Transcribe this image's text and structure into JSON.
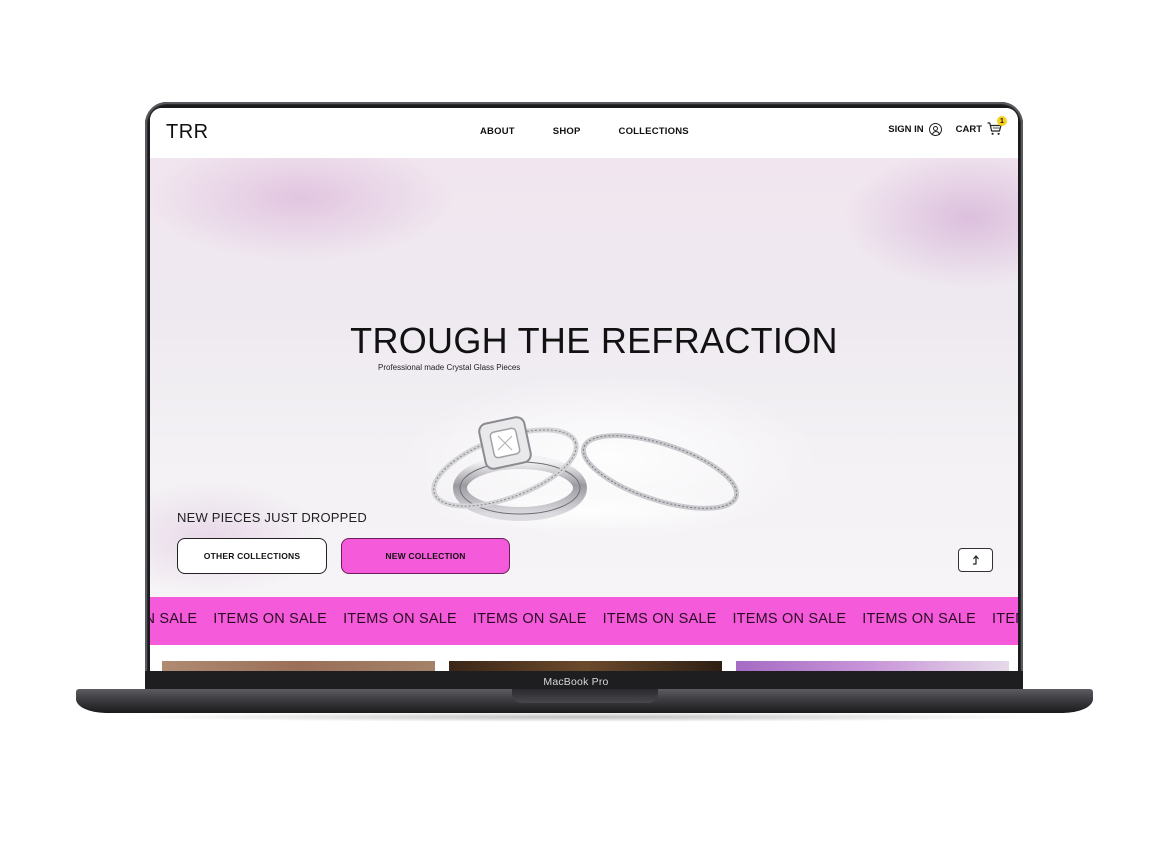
{
  "device": {
    "label": "MacBook Pro"
  },
  "nav": {
    "logo": "TRR",
    "links": [
      "ABOUT",
      "SHOP",
      "COLLECTIONS"
    ],
    "sign_in": "SIGN IN",
    "cart": "CART",
    "cart_count": "1"
  },
  "hero": {
    "title": "TROUGH THE REFRACTION",
    "subtitle": "Professional made Crystal Glass Pieces",
    "drop_text": "NEW PIECES JUST DROPPED",
    "btn_other": "OTHER COLLECTIONS",
    "btn_new": "NEW COLLECTION"
  },
  "marquee": {
    "items": [
      "ON SALE",
      "ITEMS ON SALE",
      "ITEMS ON SALE",
      "ITEMS ON SALE",
      "ITEMS ON SALE",
      "ITEMS ON SALE",
      "ITEMS ON SALE",
      "ITEMS ON SALE"
    ]
  },
  "colors": {
    "accent": "#f45ad9",
    "badge": "#f6d21c"
  },
  "icons": [
    "user-icon",
    "cart-icon",
    "arrow-up-icon"
  ]
}
